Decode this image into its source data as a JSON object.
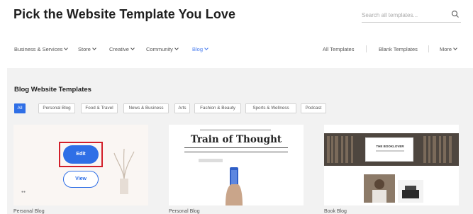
{
  "header": {
    "title": "Pick the Website Template You Love",
    "search_placeholder": "Search all templates..."
  },
  "nav": {
    "left": [
      {
        "label": "Business & Services",
        "active": false
      },
      {
        "label": "Store",
        "active": false
      },
      {
        "label": "Creative",
        "active": false
      },
      {
        "label": "Community",
        "active": false
      },
      {
        "label": "Blog",
        "active": true
      }
    ],
    "right": [
      "All Templates",
      "Blank Templates",
      "More"
    ]
  },
  "section": {
    "title": "Blog Website Templates",
    "chips": [
      "All",
      "Personal Blog",
      "Food & Travel",
      "News & Business",
      "Arts",
      "Fashion & Beauty",
      "Sports & Wellness",
      "Podcast"
    ]
  },
  "cards": [
    {
      "label": "Personal Blog",
      "edit": "Edit",
      "view": "View"
    },
    {
      "label": "Personal Blog",
      "preview_title": "Train of Thought"
    },
    {
      "label": "Book Blog",
      "preview_title": "THE BOOKLOVER"
    }
  ],
  "colors": {
    "accent": "#2f6fe6",
    "highlight": "#d21f2a",
    "background": "#f2f2f2"
  }
}
